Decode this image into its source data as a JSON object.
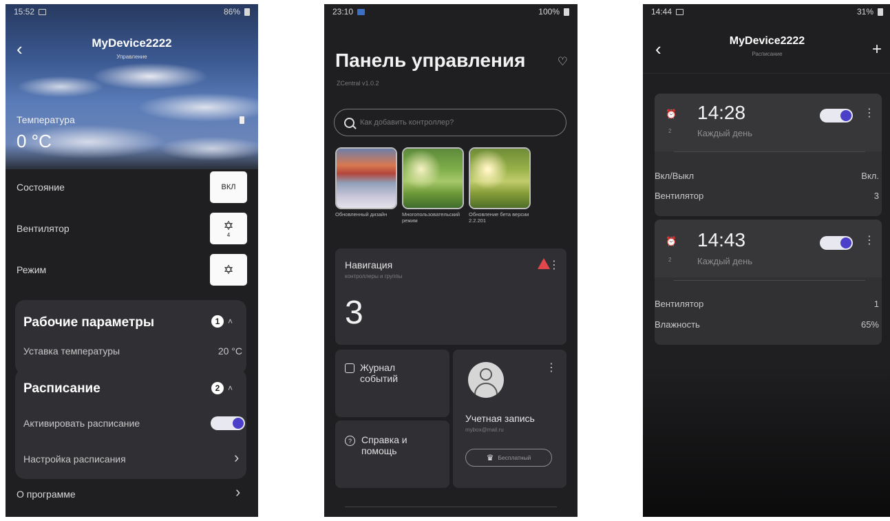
{
  "phone1": {
    "status": {
      "time": "15:52",
      "battery": "86%"
    },
    "title": "MyDevice2222",
    "subtitle": "Управление",
    "temperature": {
      "label": "Температура",
      "value": "0 °C"
    },
    "rows": [
      {
        "label": "Состояние",
        "button": "ВКЛ"
      },
      {
        "label": "Вентилятор",
        "button_icon": "fan-icon",
        "button_sub": "4"
      },
      {
        "label": "Режим",
        "button_icon": "fan-icon"
      }
    ],
    "working_params": {
      "title": "Рабочие параметры",
      "badge": "1",
      "setpoint_label": "Уставка температуры",
      "setpoint_value": "20 °C"
    },
    "schedule": {
      "title": "Расписание",
      "badge": "2",
      "activate_label": "Активировать расписание",
      "activate_on": true,
      "settings_label": "Настройка расписания"
    },
    "about": "О программе"
  },
  "phone2": {
    "status": {
      "time": "23:10",
      "battery": "100%"
    },
    "title": "Панель управления",
    "version": "ZCentral v1.0.2",
    "search_placeholder": "Как добавить контроллер?",
    "stories": [
      {
        "caption": "Обновленный дизайн"
      },
      {
        "caption": "Многопользовательский режим"
      },
      {
        "caption": "Обновление бета версии 2.2.201"
      }
    ],
    "navigation": {
      "title": "Навигация",
      "subtitle": "контроллеры и группы",
      "count": "3"
    },
    "journal": "Журнал событий",
    "help": "Справка и помощь",
    "account": {
      "title": "Учетная запись",
      "email": "mybox@mail.ru",
      "plan": "Бесплатный"
    }
  },
  "phone3": {
    "status": {
      "time": "14:44",
      "battery": "31%"
    },
    "title": "MyDevice2222",
    "subtitle": "Расписание",
    "schedules": [
      {
        "index": "2",
        "time": "14:28",
        "repeat": "Каждый день",
        "enabled": true,
        "params": [
          {
            "name": "Вкл/Выкл",
            "value": "Вкл."
          },
          {
            "name": "Вентилятор",
            "value": "3"
          }
        ]
      },
      {
        "index": "2",
        "time": "14:43",
        "repeat": "Каждый день",
        "enabled": true,
        "params": [
          {
            "name": "Вентилятор",
            "value": "1"
          },
          {
            "name": "Влажность",
            "value": "65%"
          }
        ]
      }
    ]
  },
  "colors": {
    "accent": "#4b3fc9",
    "warning": "#e0464a",
    "background": "#1f1f21",
    "card": "#303034"
  }
}
